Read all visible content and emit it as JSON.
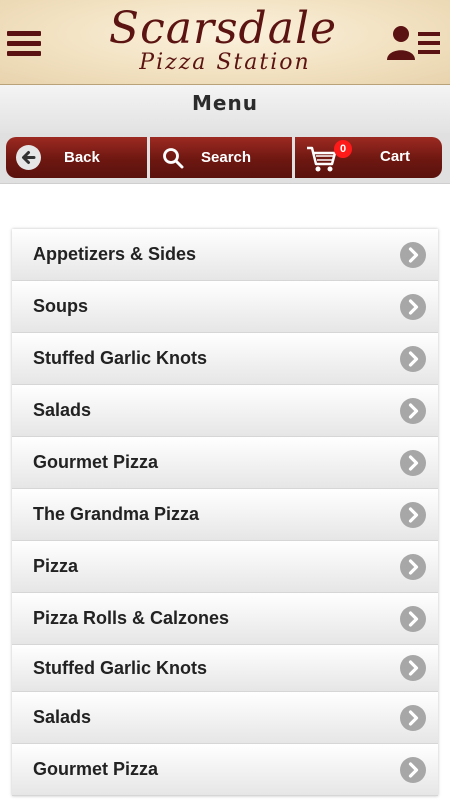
{
  "header": {
    "title": "Scarsdale",
    "subtitle": "Pizza Station",
    "menu_icon": "hamburger-icon",
    "account_icon": "user-list-icon"
  },
  "page": {
    "title": "Menu"
  },
  "toolbar": {
    "back_label": "Back",
    "search_label": "Search",
    "cart_label": "Cart",
    "cart_count": "0"
  },
  "menu": {
    "items": [
      {
        "label": "Appetizers & Sides"
      },
      {
        "label": "Soups"
      },
      {
        "label": "Stuffed Garlic Knots"
      },
      {
        "label": "Salads"
      },
      {
        "label": "Gourmet Pizza"
      },
      {
        "label": "The Grandma Pizza"
      },
      {
        "label": "Pizza"
      },
      {
        "label": "Pizza Rolls & Calzones"
      },
      {
        "label": "Stuffed Garlic Knots"
      },
      {
        "label": "Salads"
      },
      {
        "label": "Gourmet Pizza"
      }
    ]
  },
  "colors": {
    "brand_maroon": "#6e1711",
    "header_parchment": "#f2e2c2",
    "badge_red": "#ff1a1a",
    "chevron_gray": "#a7a7a7"
  }
}
